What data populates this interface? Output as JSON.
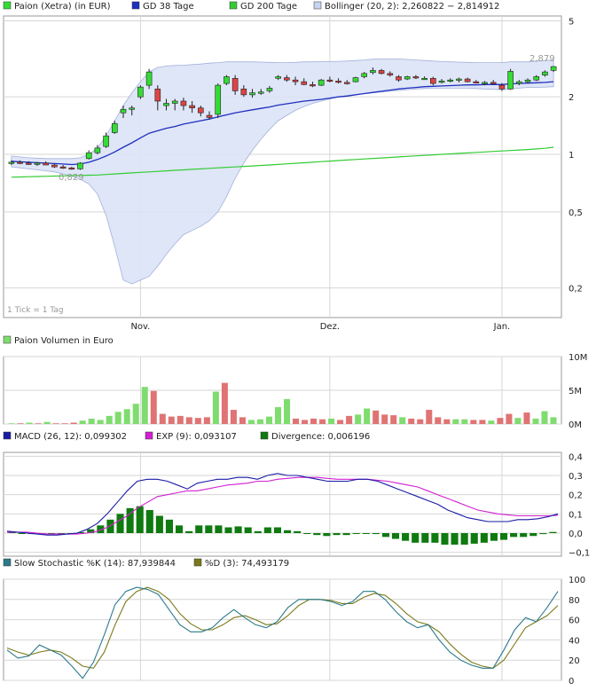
{
  "colors": {
    "frame": "#9a9a9a",
    "grid": "#d6d6d6",
    "up_fill": "#33dd33",
    "down_fill": "#dd4444",
    "candle_edge": "#222222",
    "gd38": "#1f2fbf",
    "gd200": "#33cc33",
    "bollinger_fill": "#dbe4f7",
    "bollinger_edge": "#9aa8d8",
    "vol_up": "#7fdc6f",
    "vol_down": "#e07373",
    "macd": "#1a1aa6",
    "exp": "#d21fd2",
    "divergence": "#0f7a0f",
    "stoch_k": "#2b7a8a",
    "stoch_d": "#7a7a1a",
    "annotation": "#999999"
  },
  "price_panel": {
    "legend": [
      {
        "label": "Paion (Xetra) (in EUR)",
        "swatch": "#33dd33"
      },
      {
        "label": "GD 38 Tage",
        "swatch": "#1f2fbf"
      },
      {
        "label": "GD 200 Tage",
        "swatch": "#33cc33"
      },
      {
        "label": "Bollinger (20, 2): 2,260822 − 2,814912",
        "swatch": "#c8d4f0"
      }
    ],
    "y_ticks": [
      {
        "value": 5,
        "label": "5"
      },
      {
        "value": 2,
        "label": "2"
      },
      {
        "value": 1,
        "label": "1"
      },
      {
        "value": 0.5,
        "label": "0,5"
      },
      {
        "value": 0.2,
        "label": "0,2"
      }
    ],
    "y_range": [
      0.14,
      5.3
    ],
    "log_scale": true,
    "x_labels": [
      {
        "index": 12,
        "label": "Nov."
      },
      {
        "index": 30,
        "label": "Dez."
      },
      {
        "index": 46,
        "label": "Jan."
      }
    ],
    "annotation_high": "2,879",
    "annotation_low": "0,829",
    "tick_note": "1 Tick = 1 Tag"
  },
  "chart_data": [
    {
      "type": "candlestick",
      "title": "Paion (Xetra) (in EUR)",
      "x_count": 52,
      "candles": [
        [
          0.9,
          0.93,
          0.88,
          0.91
        ],
        [
          0.91,
          0.93,
          0.89,
          0.9
        ],
        [
          0.9,
          0.92,
          0.88,
          0.89
        ],
        [
          0.89,
          0.91,
          0.87,
          0.9
        ],
        [
          0.9,
          0.92,
          0.88,
          0.88
        ],
        [
          0.88,
          0.89,
          0.85,
          0.86
        ],
        [
          0.86,
          0.88,
          0.84,
          0.85
        ],
        [
          0.85,
          0.86,
          0.83,
          0.84
        ],
        [
          0.84,
          0.91,
          0.83,
          0.9
        ],
        [
          0.95,
          1.05,
          0.94,
          1.02
        ],
        [
          1.02,
          1.12,
          1.0,
          1.08
        ],
        [
          1.1,
          1.3,
          1.08,
          1.25
        ],
        [
          1.3,
          1.5,
          1.28,
          1.45
        ],
        [
          1.65,
          1.8,
          1.55,
          1.72
        ],
        [
          1.72,
          1.8,
          1.6,
          1.75
        ],
        [
          2.0,
          2.3,
          1.95,
          2.25
        ],
        [
          2.3,
          2.8,
          2.2,
          2.7
        ],
        [
          2.2,
          2.3,
          1.7,
          1.9
        ],
        [
          1.8,
          1.95,
          1.7,
          1.85
        ],
        [
          1.85,
          1.95,
          1.7,
          1.9
        ],
        [
          1.9,
          1.98,
          1.7,
          1.8
        ],
        [
          1.8,
          1.9,
          1.65,
          1.75
        ],
        [
          1.75,
          1.8,
          1.58,
          1.65
        ],
        [
          1.6,
          1.68,
          1.52,
          1.56
        ],
        [
          1.62,
          2.35,
          1.55,
          2.3
        ],
        [
          2.35,
          2.6,
          2.3,
          2.55
        ],
        [
          2.5,
          2.6,
          2.05,
          2.15
        ],
        [
          2.2,
          2.3,
          2.0,
          2.05
        ],
        [
          2.05,
          2.2,
          1.98,
          2.1
        ],
        [
          2.1,
          2.2,
          2.05,
          2.12
        ],
        [
          2.15,
          2.28,
          2.1,
          2.22
        ],
        [
          2.5,
          2.6,
          2.45,
          2.55
        ],
        [
          2.52,
          2.6,
          2.4,
          2.45
        ],
        [
          2.45,
          2.55,
          2.3,
          2.4
        ],
        [
          2.4,
          2.5,
          2.3,
          2.32
        ],
        [
          2.32,
          2.4,
          2.25,
          2.28
        ],
        [
          2.3,
          2.48,
          2.28,
          2.45
        ],
        [
          2.45,
          2.55,
          2.38,
          2.42
        ],
        [
          2.42,
          2.5,
          2.35,
          2.38
        ],
        [
          2.38,
          2.45,
          2.32,
          2.35
        ],
        [
          2.4,
          2.55,
          2.38,
          2.52
        ],
        [
          2.55,
          2.7,
          2.5,
          2.65
        ],
        [
          2.68,
          2.85,
          2.62,
          2.75
        ],
        [
          2.75,
          2.8,
          2.62,
          2.65
        ],
        [
          2.65,
          2.72,
          2.55,
          2.6
        ],
        [
          2.55,
          2.6,
          2.4,
          2.45
        ],
        [
          2.48,
          2.58,
          2.45,
          2.55
        ],
        [
          2.55,
          2.6,
          2.48,
          2.52
        ],
        [
          2.5,
          2.56,
          2.46,
          2.5
        ],
        [
          2.5,
          2.55,
          2.3,
          2.35
        ],
        [
          2.4,
          2.48,
          2.35,
          2.42
        ],
        [
          2.42,
          2.5,
          2.38,
          2.45
        ],
        [
          2.45,
          2.52,
          2.38,
          2.48
        ],
        [
          2.48,
          2.52,
          2.38,
          2.4
        ],
        [
          2.4,
          2.45,
          2.35,
          2.36
        ],
        [
          2.36,
          2.42,
          2.3,
          2.38
        ],
        [
          2.38,
          2.45,
          2.32,
          2.34
        ],
        [
          2.3,
          2.36,
          2.15,
          2.2
        ],
        [
          2.2,
          2.8,
          2.18,
          2.72
        ],
        [
          2.35,
          2.45,
          2.3,
          2.4
        ],
        [
          2.4,
          2.5,
          2.36,
          2.45
        ],
        [
          2.45,
          2.6,
          2.42,
          2.55
        ],
        [
          2.6,
          2.75,
          2.55,
          2.7
        ],
        [
          2.75,
          2.9,
          2.7,
          2.88
        ]
      ],
      "gd38": [
        0.92,
        0.915,
        0.91,
        0.905,
        0.9,
        0.895,
        0.89,
        0.885,
        0.89,
        0.91,
        0.94,
        0.98,
        1.03,
        1.09,
        1.15,
        1.22,
        1.29,
        1.33,
        1.37,
        1.4,
        1.44,
        1.47,
        1.5,
        1.53,
        1.57,
        1.61,
        1.65,
        1.68,
        1.71,
        1.74,
        1.77,
        1.81,
        1.84,
        1.87,
        1.9,
        1.92,
        1.94,
        1.97,
        2.0,
        2.02,
        2.05,
        2.08,
        2.11,
        2.14,
        2.17,
        2.2,
        2.22,
        2.24,
        2.26,
        2.27,
        2.28,
        2.29,
        2.3,
        2.31,
        2.31,
        2.32,
        2.32,
        2.32,
        2.34,
        2.35,
        2.36,
        2.37,
        2.38,
        2.4
      ],
      "gd200": [
        0.76,
        0.762,
        0.764,
        0.766,
        0.768,
        0.77,
        0.772,
        0.774,
        0.776,
        0.778,
        0.78,
        0.785,
        0.79,
        0.795,
        0.8,
        0.805,
        0.81,
        0.815,
        0.82,
        0.825,
        0.83,
        0.835,
        0.84,
        0.845,
        0.85,
        0.855,
        0.86,
        0.865,
        0.87,
        0.875,
        0.88,
        0.886,
        0.892,
        0.898,
        0.904,
        0.91,
        0.916,
        0.922,
        0.928,
        0.934,
        0.94,
        0.946,
        0.952,
        0.958,
        0.964,
        0.97,
        0.976,
        0.982,
        0.988,
        0.994,
        1.0,
        1.006,
        1.012,
        1.018,
        1.024,
        1.03,
        1.036,
        1.042,
        1.048,
        1.054,
        1.06,
        1.068,
        1.076,
        1.09
      ],
      "bollinger_upper": [
        0.98,
        0.97,
        0.96,
        0.955,
        0.95,
        0.95,
        0.95,
        0.95,
        0.96,
        1.0,
        1.08,
        1.25,
        1.5,
        1.8,
        2.1,
        2.4,
        2.7,
        2.85,
        2.9,
        2.92,
        2.93,
        2.95,
        2.97,
        3.0,
        3.02,
        3.05,
        3.05,
        3.05,
        3.05,
        3.04,
        3.03,
        3.02,
        3.02,
        3.03,
        3.05,
        3.05,
        3.06,
        3.06,
        3.07,
        3.08,
        3.1,
        3.12,
        3.15,
        3.16,
        3.16,
        3.16,
        3.14,
        3.12,
        3.1,
        3.08,
        3.06,
        3.05,
        3.04,
        3.03,
        3.02,
        3.02,
        3.02,
        3.02,
        3.05,
        3.05,
        3.05,
        3.08,
        3.1,
        3.12
      ],
      "bollinger_lower": [
        0.86,
        0.85,
        0.84,
        0.83,
        0.82,
        0.81,
        0.79,
        0.77,
        0.74,
        0.7,
        0.62,
        0.48,
        0.33,
        0.22,
        0.21,
        0.22,
        0.23,
        0.26,
        0.3,
        0.34,
        0.38,
        0.4,
        0.42,
        0.45,
        0.5,
        0.6,
        0.75,
        0.9,
        1.05,
        1.2,
        1.35,
        1.5,
        1.6,
        1.7,
        1.78,
        1.85,
        1.9,
        1.95,
        2.0,
        2.03,
        2.06,
        2.08,
        2.1,
        2.12,
        2.14,
        2.16,
        2.18,
        2.2,
        2.21,
        2.22,
        2.22,
        2.22,
        2.22,
        2.22,
        2.21,
        2.2,
        2.19,
        2.18,
        2.2,
        2.22,
        2.24,
        2.24,
        2.25,
        2.26
      ]
    },
    {
      "type": "bar",
      "title": "Paion Volumen in Euro",
      "y_ticks": [
        {
          "value": 10,
          "label": "10M"
        },
        {
          "value": 5,
          "label": "5M"
        },
        {
          "value": 0,
          "label": "0M"
        }
      ],
      "ylim": [
        0,
        10
      ],
      "values": [
        0.1,
        0.1,
        0.2,
        0.1,
        0.3,
        0.1,
        0.1,
        0.2,
        0.5,
        0.8,
        0.6,
        1.2,
        1.8,
        2.2,
        3.0,
        5.5,
        4.9,
        1.5,
        1.1,
        1.2,
        1.0,
        0.9,
        1.0,
        4.8,
        6.1,
        2.1,
        1.0,
        0.6,
        0.7,
        1.1,
        2.5,
        3.7,
        0.8,
        0.6,
        0.8,
        0.7,
        0.8,
        0.6,
        1.2,
        1.4,
        2.3,
        2.0,
        1.4,
        1.3,
        1.0,
        0.8,
        0.7,
        2.1,
        1.0,
        0.7,
        0.7,
        0.7,
        0.6,
        0.6,
        0.5,
        0.9,
        1.5,
        0.9,
        1.7,
        0.8,
        1.9,
        1.0
      ],
      "up": [
        true,
        false,
        true,
        false,
        true,
        false,
        false,
        false,
        true,
        true,
        true,
        true,
        true,
        true,
        true,
        true,
        false,
        false,
        false,
        false,
        false,
        false,
        false,
        true,
        false,
        false,
        false,
        true,
        true,
        true,
        true,
        true,
        false,
        false,
        false,
        false,
        true,
        false,
        false,
        true,
        true,
        false,
        false,
        false,
        true,
        false,
        false,
        false,
        false,
        false,
        true,
        true,
        false,
        false,
        true,
        false,
        false,
        true,
        false,
        true,
        true,
        true
      ]
    },
    {
      "type": "line",
      "title": "MACD (26, 12)",
      "legend": [
        {
          "label": "MACD (26, 12): 0,099302",
          "color": "#1a1aa6"
        },
        {
          "label": "EXP (9): 0,093107",
          "color": "#d21fd2"
        },
        {
          "label": "Divergence: 0,006196",
          "color": "#0f7a0f"
        }
      ],
      "y_ticks": [
        {
          "value": 0.4,
          "label": "0,4"
        },
        {
          "value": 0.3,
          "label": "0,3"
        },
        {
          "value": 0.2,
          "label": "0,2"
        },
        {
          "value": 0.1,
          "label": "0,1"
        },
        {
          "value": 0.0,
          "label": "0,0"
        },
        {
          "value": -0.1,
          "label": "−0,1"
        }
      ],
      "ylim": [
        -0.12,
        0.42
      ],
      "series": [
        {
          "name": "MACD",
          "values": [
            0.01,
            0.005,
            0.0,
            -0.005,
            -0.01,
            -0.01,
            -0.005,
            0.0,
            0.02,
            0.05,
            0.1,
            0.16,
            0.22,
            0.27,
            0.28,
            0.28,
            0.27,
            0.25,
            0.23,
            0.26,
            0.27,
            0.28,
            0.28,
            0.29,
            0.29,
            0.28,
            0.3,
            0.31,
            0.3,
            0.3,
            0.29,
            0.28,
            0.27,
            0.27,
            0.27,
            0.28,
            0.28,
            0.27,
            0.25,
            0.23,
            0.21,
            0.19,
            0.17,
            0.15,
            0.12,
            0.1,
            0.08,
            0.07,
            0.06,
            0.06,
            0.06,
            0.07,
            0.07,
            0.075,
            0.085,
            0.1
          ]
        },
        {
          "name": "EXP",
          "values": [
            0.005,
            0.005,
            0.005,
            0.0,
            -0.005,
            -0.005,
            -0.005,
            -0.005,
            0.0,
            0.01,
            0.03,
            0.06,
            0.09,
            0.13,
            0.16,
            0.19,
            0.2,
            0.21,
            0.22,
            0.22,
            0.23,
            0.24,
            0.25,
            0.255,
            0.26,
            0.27,
            0.27,
            0.28,
            0.285,
            0.29,
            0.29,
            0.29,
            0.285,
            0.28,
            0.28,
            0.28,
            0.28,
            0.275,
            0.27,
            0.26,
            0.25,
            0.24,
            0.22,
            0.2,
            0.18,
            0.16,
            0.14,
            0.12,
            0.11,
            0.1,
            0.095,
            0.09,
            0.09,
            0.09,
            0.09,
            0.093
          ]
        }
      ],
      "divergence": [
        0.005,
        0.0,
        -0.005,
        -0.005,
        -0.005,
        -0.005,
        0.0,
        0.005,
        0.02,
        0.04,
        0.07,
        0.1,
        0.13,
        0.14,
        0.12,
        0.09,
        0.07,
        0.04,
        0.01,
        0.04,
        0.04,
        0.04,
        0.03,
        0.035,
        0.03,
        0.01,
        0.03,
        0.03,
        0.015,
        0.01,
        0.0,
        -0.01,
        -0.015,
        -0.01,
        -0.01,
        0.0,
        0.0,
        -0.005,
        -0.02,
        -0.03,
        -0.04,
        -0.05,
        -0.05,
        -0.05,
        -0.06,
        -0.06,
        -0.06,
        -0.055,
        -0.05,
        -0.04,
        -0.035,
        -0.02,
        -0.02,
        -0.015,
        -0.005,
        0.006
      ]
    },
    {
      "type": "line",
      "title": "Slow Stochastic",
      "legend": [
        {
          "label": "Slow Stochastic %K (14): 87,939844",
          "color": "#2b7a8a"
        },
        {
          "label": "%D (3): 74,493179",
          "color": "#7a7a1a"
        }
      ],
      "y_ticks": [
        {
          "value": 100,
          "label": "100"
        },
        {
          "value": 80,
          "label": "80"
        },
        {
          "value": 60,
          "label": "60"
        },
        {
          "value": 40,
          "label": "40"
        },
        {
          "value": 20,
          "label": "20"
        },
        {
          "value": 0,
          "label": "0"
        }
      ],
      "ylim": [
        0,
        100
      ],
      "series": [
        {
          "name": "%K",
          "values": [
            30,
            22,
            24,
            35,
            30,
            25,
            14,
            2,
            18,
            45,
            75,
            88,
            92,
            90,
            85,
            70,
            55,
            48,
            48,
            52,
            62,
            70,
            62,
            55,
            52,
            58,
            72,
            80,
            80,
            80,
            78,
            74,
            78,
            88,
            88,
            80,
            68,
            58,
            52,
            55,
            40,
            28,
            20,
            15,
            12,
            12,
            30,
            50,
            62,
            58,
            72,
            88
          ]
        },
        {
          "name": "%D",
          "values": [
            32,
            28,
            25,
            28,
            30,
            28,
            22,
            14,
            12,
            28,
            55,
            78,
            88,
            92,
            88,
            80,
            66,
            56,
            50,
            50,
            55,
            62,
            64,
            60,
            55,
            56,
            64,
            74,
            80,
            80,
            79,
            76,
            76,
            82,
            86,
            84,
            76,
            66,
            58,
            55,
            48,
            36,
            26,
            18,
            14,
            12,
            20,
            36,
            52,
            58,
            64,
            74
          ]
        }
      ]
    }
  ],
  "volume_panel": {
    "legend_label": "Paion Volumen in Euro"
  },
  "macd_panel": {
    "legend": [
      "MACD (26, 12): 0,099302",
      "EXP (9): 0,093107",
      "Divergence: 0,006196"
    ]
  },
  "stoch_panel": {
    "legend": [
      "Slow Stochastic %K (14): 87,939844",
      "%D (3): 74,493179"
    ]
  }
}
